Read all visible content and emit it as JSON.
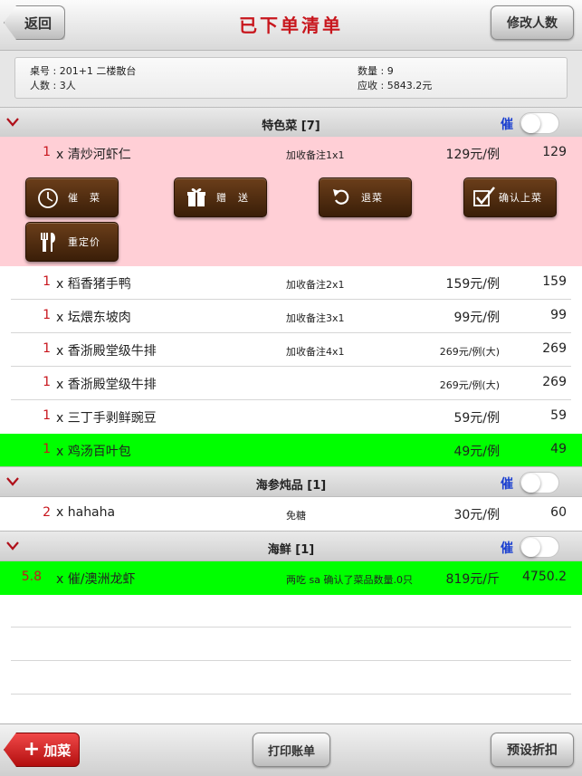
{
  "header": {
    "back_label": "返回",
    "title": "已下单清单",
    "modify_label": "修改人数"
  },
  "info": {
    "table": "桌号 : 201+1 二楼散台",
    "people": "人数 : 3人",
    "count": "数量 : 9",
    "receivable": "应收 : 5843.2元"
  },
  "sections": [
    {
      "title": "特色菜 [7]",
      "urge": "催",
      "items": [
        {
          "qty": "1",
          "name": "x 清炒河虾仁",
          "note": "加收备注1x1",
          "price": "129元/例",
          "total": "129",
          "bg": "pink"
        },
        {
          "qty": "1",
          "name": "x 稻香猪手鸭",
          "note": "加收备注2x1",
          "price": "159元/例",
          "total": "159",
          "bg": "white"
        },
        {
          "qty": "1",
          "name": "x 坛煨东坡肉",
          "note": "加收备注3x1",
          "price": "99元/例",
          "total": "99",
          "bg": "white"
        },
        {
          "qty": "1",
          "name": "x 香浙殿堂级牛排",
          "note": "加收备注4x1",
          "price": "269元/例(大)",
          "total": "269",
          "bg": "white"
        },
        {
          "qty": "1",
          "name": "x 香浙殿堂级牛排",
          "note": "",
          "price": "269元/例(大)",
          "total": "269",
          "bg": "white"
        },
        {
          "qty": "1",
          "name": "x 三丁手剥鲜豌豆",
          "note": "",
          "price": "59元/例",
          "total": "59",
          "bg": "white"
        },
        {
          "qty": "1",
          "name": "x 鸡汤百叶包",
          "note": "",
          "price": "49元/例",
          "total": "49",
          "bg": "green"
        }
      ]
    },
    {
      "title": "海参炖品 [1]",
      "urge": "催",
      "items": [
        {
          "qty": "2",
          "name": "x hahaha",
          "note": "免糖",
          "price": "30元/例",
          "total": "60",
          "bg": "white"
        }
      ]
    },
    {
      "title": "海鲜 [1]",
      "urge": "催",
      "items": [
        {
          "qty": "5.8",
          "name": "x 催/澳洲龙虾",
          "note": "两吃 sa 确认了菜品数量.0只",
          "price": "819元/斤",
          "total": "4750.2",
          "bg": "green"
        }
      ]
    }
  ],
  "actions": {
    "urge_dish": "催　菜",
    "gift": "赠　送",
    "return_dish": "退菜",
    "confirm_serve": "确认上菜",
    "reprice": "重定价"
  },
  "footer": {
    "add_label": "加菜",
    "add_icon": "+",
    "print_label": "打印账单",
    "discount_label": "预设折扣"
  },
  "colors": {
    "title_red": "#c8161d",
    "urge_blue": "#1a3fd0",
    "selected_pink": "#ffcfd6",
    "served_green": "#00ff00",
    "action_brown": "#4a2a0e"
  }
}
